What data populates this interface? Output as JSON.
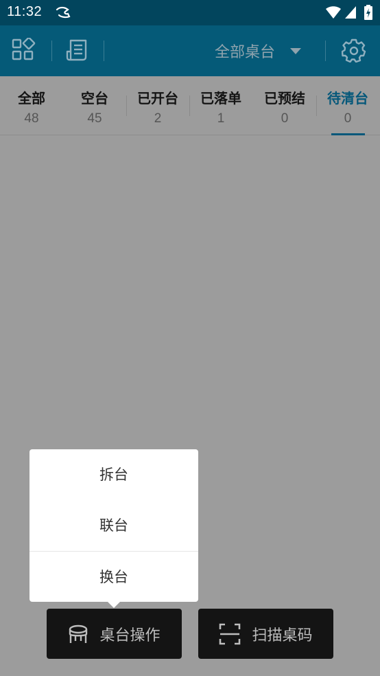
{
  "status_bar": {
    "time": "11:32",
    "icons": [
      "app-notification-icon",
      "wifi-icon",
      "signal-icon",
      "battery-charging-icon"
    ]
  },
  "toolbar": {
    "icons": [
      "grid-apps-icon",
      "receipt-icon",
      "settings-gear-icon"
    ],
    "table_filter": "全部桌台"
  },
  "tabs": [
    {
      "label": "全部",
      "count": "48"
    },
    {
      "label": "空台",
      "count": "45"
    },
    {
      "label": "已开台",
      "count": "2"
    },
    {
      "label": "已落单",
      "count": "1"
    },
    {
      "label": "已预结",
      "count": "0"
    },
    {
      "label": "待清台",
      "count": "0"
    }
  ],
  "active_tab": "待清台",
  "popup_menu": {
    "items": [
      "拆台",
      "联台",
      "换台"
    ]
  },
  "bottom_buttons": {
    "table_ops": "桌台操作",
    "scan_code": "扫描桌码"
  },
  "colors": {
    "status_bar": "#02455d",
    "toolbar": "#055a78",
    "accent": "#06587a",
    "overlay_bg": "#9c9c9c",
    "button_bg": "#141414"
  }
}
